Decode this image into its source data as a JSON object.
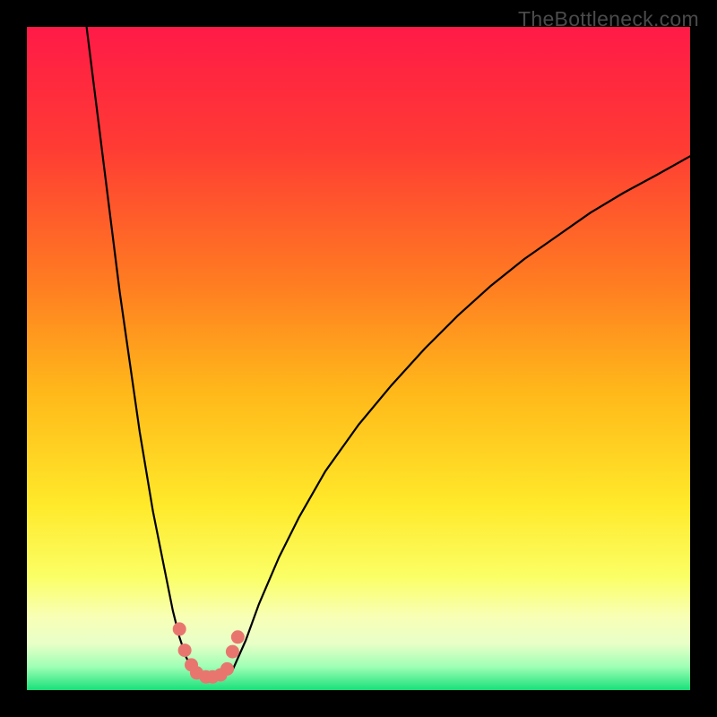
{
  "watermark": "TheBottleneck.com",
  "chart_data": {
    "type": "line",
    "title": "",
    "xlabel": "",
    "ylabel": "",
    "xlim": [
      0,
      100
    ],
    "ylim": [
      0,
      100
    ],
    "gradient_stops": [
      {
        "offset": 0.0,
        "color": "#ff1a47"
      },
      {
        "offset": 0.18,
        "color": "#ff3b34"
      },
      {
        "offset": 0.38,
        "color": "#ff7a22"
      },
      {
        "offset": 0.55,
        "color": "#ffb81a"
      },
      {
        "offset": 0.72,
        "color": "#ffe92a"
      },
      {
        "offset": 0.83,
        "color": "#fbff66"
      },
      {
        "offset": 0.89,
        "color": "#f8ffb6"
      },
      {
        "offset": 0.93,
        "color": "#e8ffc8"
      },
      {
        "offset": 0.965,
        "color": "#9effb4"
      },
      {
        "offset": 1.0,
        "color": "#18e07a"
      }
    ],
    "series": [
      {
        "name": "curve",
        "stroke": "#000000",
        "stroke_width": 2.2,
        "x": [
          9,
          10,
          11,
          12,
          13,
          14,
          15,
          16,
          17,
          18,
          19,
          20,
          21,
          22,
          23,
          24,
          25,
          26,
          27,
          28,
          29,
          30,
          31,
          33,
          35,
          38,
          41,
          45,
          50,
          55,
          60,
          65,
          70,
          75,
          80,
          85,
          90,
          95,
          100
        ],
        "y": [
          100,
          92,
          84,
          76,
          68,
          60,
          53,
          46,
          39,
          33,
          27,
          22,
          17,
          12,
          8,
          5,
          3,
          2.2,
          2,
          2,
          2,
          2.4,
          3,
          7.5,
          13,
          20,
          26,
          33,
          40,
          46,
          51.5,
          56.5,
          61,
          65,
          68.5,
          72,
          75,
          77.7,
          80.5
        ]
      }
    ],
    "markers": {
      "name": "highlight-points",
      "fill": "#e8766f",
      "radius": 7.5,
      "x": [
        23.0,
        23.8,
        24.8,
        25.6,
        27.0,
        28.0,
        29.2,
        30.2,
        31.0,
        31.8
      ],
      "y": [
        9.2,
        6.0,
        3.8,
        2.6,
        2.0,
        2.0,
        2.3,
        3.2,
        5.8,
        8.0
      ]
    }
  }
}
